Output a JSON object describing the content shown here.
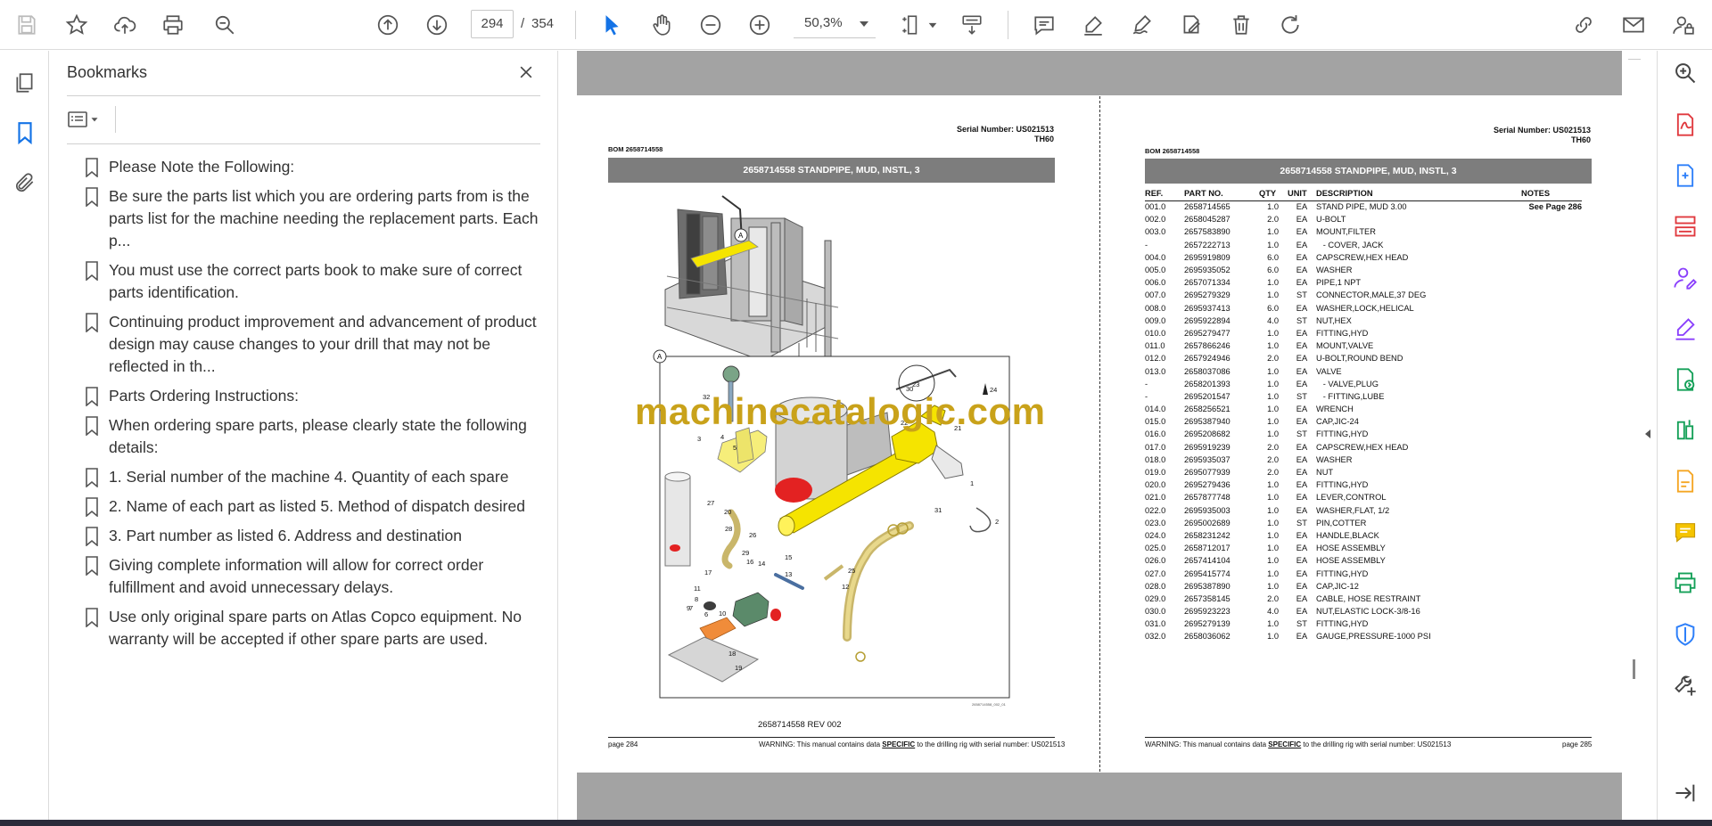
{
  "toolbar": {
    "current_page": "294",
    "page_separator": "/",
    "total_pages": "354",
    "zoom": "50,3%"
  },
  "bookmarks_panel": {
    "title": "Bookmarks",
    "items": [
      {
        "label": "Please Note the Following:"
      },
      {
        "label": "Be sure the parts list which you are ordering parts from is the parts list for the machine needing the replacement parts. Each p..."
      },
      {
        "label": "You must use the correct parts book to make sure of correct parts identification."
      },
      {
        "label": "Continuing product improvement and advancement of product design may cause changes to your drill that may not be reflected in th..."
      },
      {
        "label": "Parts Ordering Instructions:"
      },
      {
        "label": "When ordering spare parts, please clearly state the following details:"
      },
      {
        "label": "1. Serial number of the machine 4. Quantity of each spare"
      },
      {
        "label": "2. Name of each part as listed 5. Method of dispatch desired"
      },
      {
        "label": "3. Part number as listed 6. Address and destination"
      },
      {
        "label": "Giving complete information will allow for correct order fulfillment and avoid unnecessary delays."
      },
      {
        "label": "Use only original spare parts on Atlas Copco equipment. No warranty will be accepted if other spare parts are used."
      }
    ]
  },
  "left_page": {
    "serial": "Serial Number: US021513",
    "model": "TH60",
    "bom": "BOM 2658714558",
    "header": "2658714558 STANDPIPE, MUD, INSTL, 3",
    "drawing_caption": "2658714558 REV 002",
    "footer_page": "page 284",
    "footer_warning_pre": "WARNING:  This manual contains data ",
    "footer_warning_specific": "SPECIFIC",
    "footer_warning_post": " to the drilling rig with serial number: US021513",
    "detail_label": "A",
    "drawing_small_code": "2658714558_002_01"
  },
  "right_page": {
    "serial": "Serial Number: US021513",
    "model": "TH60",
    "bom": "BOM 2658714558",
    "header": "2658714558 STANDPIPE, MUD, INSTL, 3",
    "footer_page": "page 285",
    "footer_warning_pre": "WARNING:  This manual contains data ",
    "footer_warning_specific": "SPECIFIC",
    "footer_warning_post": " to the drilling rig with serial number: US021513",
    "columns": [
      "REF.",
      "PART NO.",
      "QTY",
      "UNIT",
      "DESCRIPTION",
      "NOTES"
    ],
    "rows": [
      [
        "001.0",
        "2658714565",
        "1.0",
        "EA",
        "STAND PIPE, MUD 3.00",
        "See Page 286"
      ],
      [
        "002.0",
        "2658045287",
        "2.0",
        "EA",
        "U-BOLT",
        ""
      ],
      [
        "003.0",
        "2657583890",
        "1.0",
        "EA",
        "MOUNT,FILTER",
        ""
      ],
      [
        "-",
        "2657222713",
        "1.0",
        "EA",
        "   - COVER, JACK",
        ""
      ],
      [
        "004.0",
        "2695919809",
        "6.0",
        "EA",
        "CAPSCREW,HEX HEAD",
        ""
      ],
      [
        "005.0",
        "2695935052",
        "6.0",
        "EA",
        "WASHER",
        ""
      ],
      [
        "006.0",
        "2657071334",
        "1.0",
        "EA",
        "PIPE,1 NPT",
        ""
      ],
      [
        "007.0",
        "2695279329",
        "1.0",
        "ST",
        "CONNECTOR,MALE,37 DEG",
        ""
      ],
      [
        "008.0",
        "2695937413",
        "6.0",
        "EA",
        "WASHER,LOCK,HELICAL",
        ""
      ],
      [
        "009.0",
        "2695922894",
        "4.0",
        "ST",
        "NUT,HEX",
        ""
      ],
      [
        "010.0",
        "2695279477",
        "1.0",
        "EA",
        "FITTING,HYD",
        ""
      ],
      [
        "011.0",
        "2657866246",
        "1.0",
        "EA",
        "MOUNT,VALVE",
        ""
      ],
      [
        "012.0",
        "2657924946",
        "2.0",
        "EA",
        "U-BOLT,ROUND BEND",
        ""
      ],
      [
        "013.0",
        "2658037086",
        "1.0",
        "EA",
        "VALVE",
        ""
      ],
      [
        "-",
        "2658201393",
        "1.0",
        "EA",
        "   - VALVE,PLUG",
        ""
      ],
      [
        "-",
        "2695201547",
        "1.0",
        "ST",
        "   - FITTING,LUBE",
        ""
      ],
      [
        "014.0",
        "2658256521",
        "1.0",
        "EA",
        "WRENCH",
        ""
      ],
      [
        "015.0",
        "2695387940",
        "1.0",
        "EA",
        "CAP,JIC-24",
        ""
      ],
      [
        "016.0",
        "2695208682",
        "1.0",
        "ST",
        "FITTING,HYD",
        ""
      ],
      [
        "017.0",
        "2695919239",
        "2.0",
        "EA",
        "CAPSCREW,HEX HEAD",
        ""
      ],
      [
        "018.0",
        "2695935037",
        "2.0",
        "EA",
        "WASHER",
        ""
      ],
      [
        "019.0",
        "2695077939",
        "2.0",
        "EA",
        "NUT",
        ""
      ],
      [
        "020.0",
        "2695279436",
        "1.0",
        "EA",
        "FITTING,HYD",
        ""
      ],
      [
        "021.0",
        "2657877748",
        "1.0",
        "EA",
        "LEVER,CONTROL",
        ""
      ],
      [
        "022.0",
        "2695935003",
        "1.0",
        "EA",
        "WASHER,FLAT, 1/2",
        ""
      ],
      [
        "023.0",
        "2695002689",
        "1.0",
        "ST",
        "PIN,COTTER",
        ""
      ],
      [
        "024.0",
        "2658231242",
        "1.0",
        "EA",
        "HANDLE,BLACK",
        ""
      ],
      [
        "025.0",
        "2658712017",
        "1.0",
        "EA",
        "HOSE ASSEMBLY",
        ""
      ],
      [
        "026.0",
        "2657414104",
        "1.0",
        "EA",
        "HOSE ASSEMBLY",
        ""
      ],
      [
        "027.0",
        "2695415774",
        "1.0",
        "EA",
        "FITTING,HYD",
        ""
      ],
      [
        "028.0",
        "2695387890",
        "1.0",
        "EA",
        "CAP,JIC-12",
        ""
      ],
      [
        "029.0",
        "2657358145",
        "2.0",
        "EA",
        "CABLE, HOSE RESTRAINT",
        ""
      ],
      [
        "030.0",
        "2695923223",
        "4.0",
        "EA",
        "NUT,ELASTIC LOCK-3/8-16",
        ""
      ],
      [
        "031.0",
        "2695279139",
        "1.0",
        "ST",
        "FITTING,HYD",
        ""
      ],
      [
        "032.0",
        "2658036062",
        "1.0",
        "EA",
        "GAUGE,PRESSURE-1000 PSI",
        ""
      ]
    ]
  },
  "watermark": "machinecatalogic.com",
  "callouts": [
    "32",
    "3",
    "4",
    "5",
    "30",
    "23",
    "22",
    "24",
    "21",
    "1",
    "27",
    "20",
    "31",
    "2",
    "28",
    "26",
    "14",
    "29",
    "15",
    "16",
    "13",
    "17",
    "25",
    "12",
    "11",
    "7",
    "8",
    "9",
    "6",
    "10",
    "18",
    "19"
  ]
}
